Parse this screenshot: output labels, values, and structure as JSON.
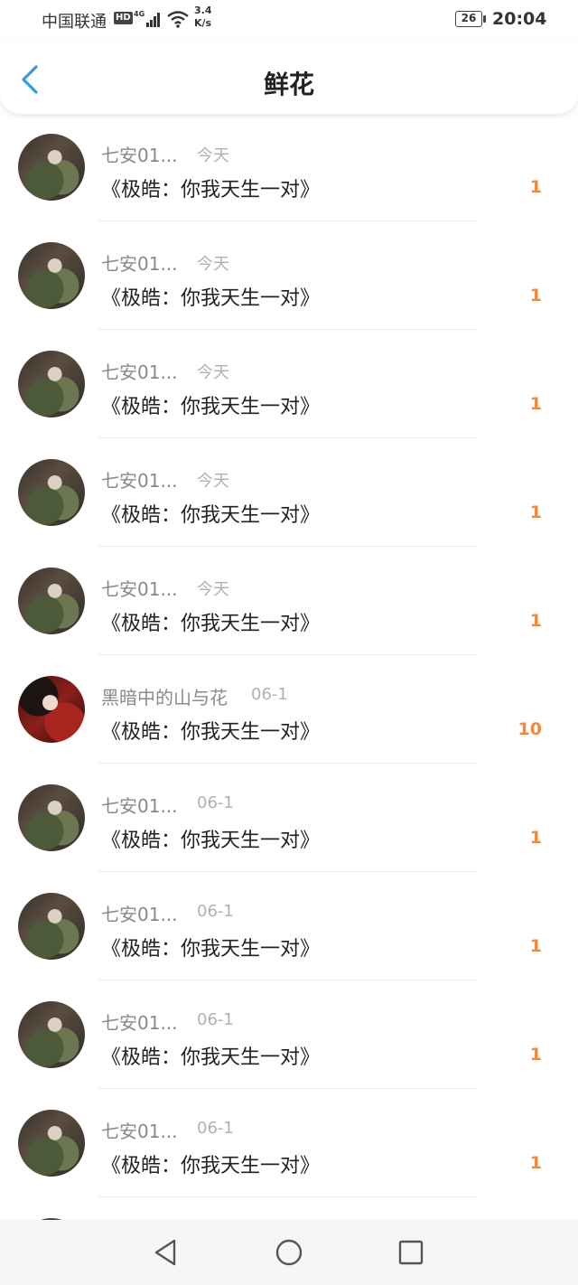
{
  "status_bar": {
    "carrier": "中国联通",
    "hd_badge": "HD",
    "network_speed_value": "3.4",
    "network_speed_unit": "K/s",
    "battery_level": "26",
    "time": "20:04",
    "signal_icon": "signal-icon",
    "wifi_icon": "wifi-icon"
  },
  "header": {
    "title": "鲜花",
    "back_icon": "chevron-left-icon",
    "accent_color": "#2f9be0"
  },
  "list": {
    "items": [
      {
        "name": "七安01...",
        "date": "今天",
        "content": "《极皓：你我天生一对》",
        "count": "1"
      },
      {
        "name": "七安01...",
        "date": "今天",
        "content": "《极皓：你我天生一对》",
        "count": "1"
      },
      {
        "name": "七安01...",
        "date": "今天",
        "content": "《极皓：你我天生一对》",
        "count": "1"
      },
      {
        "name": "七安01...",
        "date": "今天",
        "content": "《极皓：你我天生一对》",
        "count": "1"
      },
      {
        "name": "七安01...",
        "date": "今天",
        "content": "《极皓：你我天生一对》",
        "count": "1"
      },
      {
        "name": "黑暗中的山与花",
        "date": "06-1",
        "content": "《极皓：你我天生一对》",
        "count": "10"
      },
      {
        "name": "七安01...",
        "date": "06-1",
        "content": "《极皓：你我天生一对》",
        "count": "1"
      },
      {
        "name": "七安01...",
        "date": "06-1",
        "content": "《极皓：你我天生一对》",
        "count": "1"
      },
      {
        "name": "七安01...",
        "date": "06-1",
        "content": "《极皓：你我天生一对》",
        "count": "1"
      },
      {
        "name": "七安01...",
        "date": "06-1",
        "content": "《极皓：你我天生一对》",
        "count": "1"
      }
    ],
    "count_color": "#f0883a"
  },
  "nav_bar": {
    "back_icon": "triangle-back-icon",
    "home_icon": "circle-home-icon",
    "recents_icon": "square-recents-icon"
  }
}
